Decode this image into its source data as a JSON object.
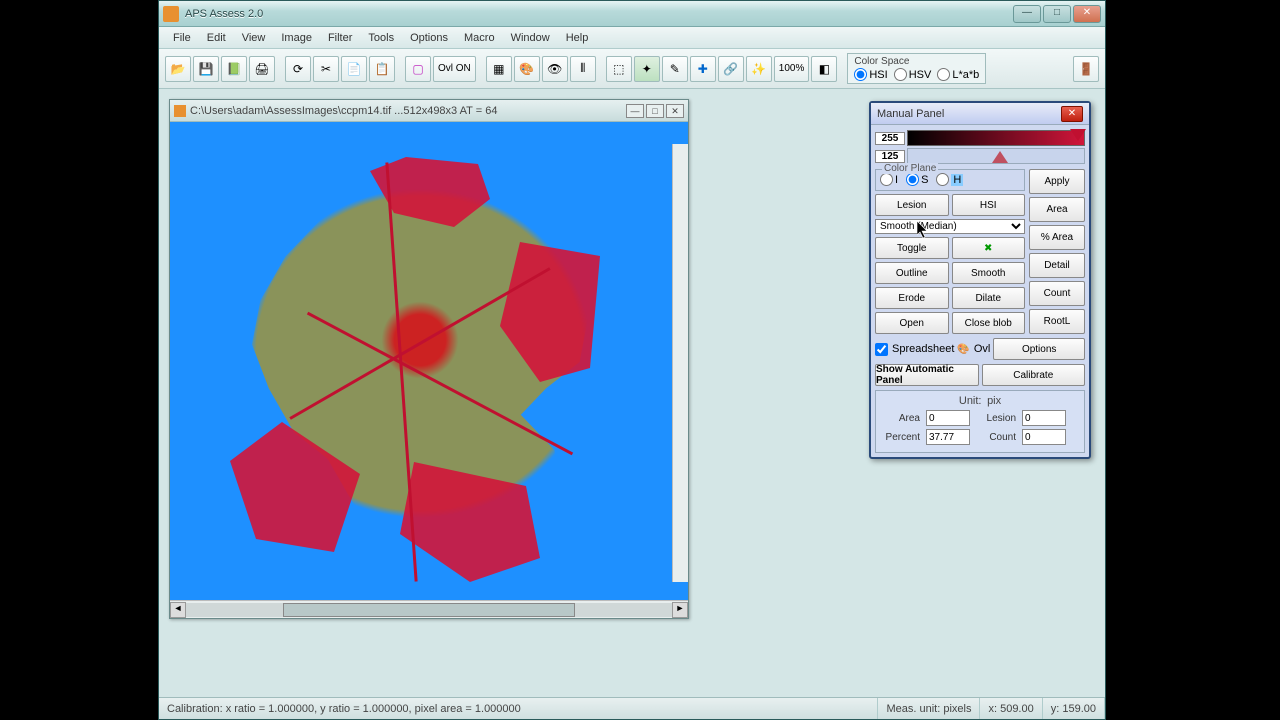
{
  "title": "APS Assess 2.0",
  "menus": [
    "File",
    "Edit",
    "View",
    "Image",
    "Filter",
    "Tools",
    "Options",
    "Macro",
    "Window",
    "Help"
  ],
  "toolbar": {
    "ovl": "Ovl ON",
    "zoom": "100%",
    "colorspace_label": "Color Space",
    "cs_options": [
      "HSI",
      "HSV",
      "L*a*b"
    ],
    "cs_selected": "HSI"
  },
  "imgwin": {
    "title": "C:\\Users\\adam\\AssessImages\\ccpm14.tif  ...512x498x3    AT = 64"
  },
  "panel": {
    "title": "Manual Panel",
    "thresh_hi": "255",
    "thresh_lo": "125",
    "colorplane_label": "Color Plane",
    "cp_options": [
      "I",
      "S",
      "H"
    ],
    "cp_selected": "S",
    "apply": "Apply",
    "btn_lesion": "Lesion",
    "btn_hsi": "HSI",
    "combo": "Smooth (Median)",
    "btn_toggle": "Toggle",
    "btn_outline": "Outline",
    "btn_smooth": "Smooth",
    "btn_erode": "Erode",
    "btn_dilate": "Dilate",
    "btn_open": "Open",
    "btn_closeblob": "Close blob",
    "btn_area": "Area",
    "btn_pctarea": "% Area",
    "btn_detail": "Detail",
    "btn_count": "Count",
    "btn_rootl": "RootL",
    "btn_options": "Options",
    "btn_calibrate": "Calibrate",
    "chk_spread": "Spreadsheet",
    "chk_ovl": "Ovl",
    "automatic": "Show Automatic Panel",
    "unit_label": "Unit:",
    "unit_value": "pix",
    "ro_area_label": "Area",
    "ro_area": "0",
    "ro_lesion_label": "Lesion",
    "ro_lesion": "0",
    "ro_percent_label": "Percent",
    "ro_percent": "37.77",
    "ro_count_label": "Count",
    "ro_count": "0"
  },
  "status": {
    "calib": "Calibration:  x ratio = 1.000000, y ratio = 1.000000, pixel area = 1.000000",
    "unit": "Meas. unit: pixels",
    "x": "x: 509.00",
    "y": "y: 159.00"
  }
}
